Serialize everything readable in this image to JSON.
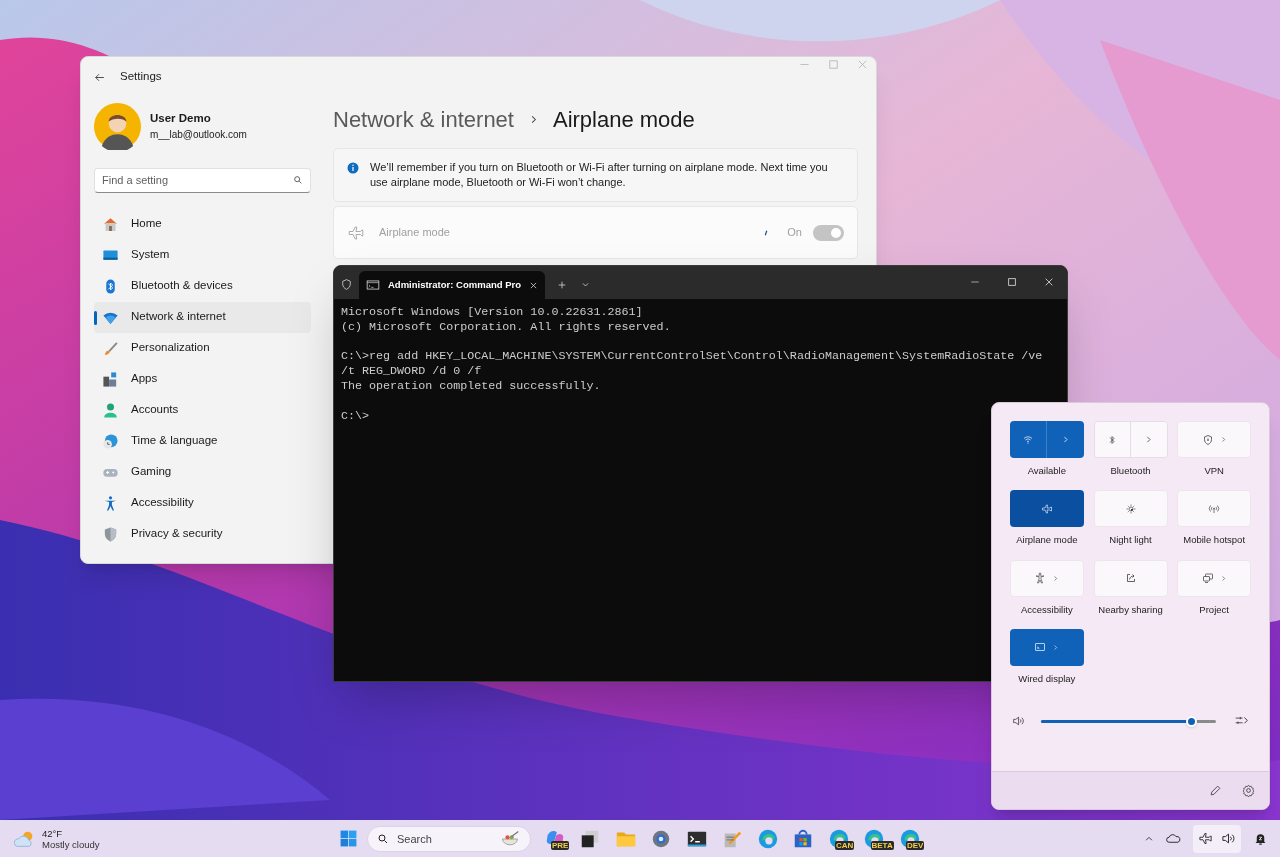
{
  "settings": {
    "title": "Settings",
    "user": {
      "name": "User Demo",
      "email": "m__lab@outlook.com"
    },
    "search": {
      "placeholder": "Find a setting"
    },
    "nav": [
      {
        "label": "Home",
        "selected": false
      },
      {
        "label": "System",
        "selected": false
      },
      {
        "label": "Bluetooth & devices",
        "selected": false
      },
      {
        "label": "Network & internet",
        "selected": true
      },
      {
        "label": "Personalization",
        "selected": false
      },
      {
        "label": "Apps",
        "selected": false
      },
      {
        "label": "Accounts",
        "selected": false
      },
      {
        "label": "Time & language",
        "selected": false
      },
      {
        "label": "Gaming",
        "selected": false
      },
      {
        "label": "Accessibility",
        "selected": false
      },
      {
        "label": "Privacy & security",
        "selected": false
      }
    ],
    "breadcrumb": {
      "parent": "Network & internet",
      "current": "Airplane mode"
    },
    "info": "We’ll remember if you turn on Bluetooth or Wi-Fi after turning on airplane mode. Next time you use airplane mode, Bluetooth or Wi-Fi won’t change.",
    "airplane": {
      "label": "Airplane mode",
      "state": "On",
      "on": true,
      "disabled": true
    }
  },
  "terminal": {
    "tab_title": "Administrator: Command Pro",
    "blocks": [
      [
        "Microsoft Windows [Version 10.0.22631.2861]",
        "(c) Microsoft Corporation. All rights reserved."
      ],
      [
        "C:\\>reg add HKEY_LOCAL_MACHINE\\SYSTEM\\CurrentControlSet\\Control\\RadioManagement\\SystemRadioState /ve",
        "/t REG_DWORD /d 0 /f",
        "The operation completed successfully."
      ],
      [
        "C:\\>"
      ]
    ]
  },
  "quick_settings": {
    "tiles": [
      {
        "label": "Available",
        "kind": "split",
        "on": true
      },
      {
        "label": "Bluetooth",
        "kind": "split",
        "on": false
      },
      {
        "label": "VPN",
        "kind": "arrow",
        "on": false
      },
      {
        "label": "Airplane mode",
        "kind": "plain",
        "on": true
      },
      {
        "label": "Night light",
        "kind": "plain",
        "on": false
      },
      {
        "label": "Mobile hotspot",
        "kind": "plain",
        "on": false
      },
      {
        "label": "Accessibility",
        "kind": "arrow",
        "on": false
      },
      {
        "label": "Nearby sharing",
        "kind": "plain",
        "on": false
      },
      {
        "label": "Project",
        "kind": "arrow",
        "on": false
      },
      {
        "label": "Wired display",
        "kind": "arrow",
        "on": true
      }
    ],
    "volume": {
      "level": 0.855
    }
  },
  "taskbar": {
    "weather": {
      "temp": "42°F",
      "desc": "Mostly cloudy"
    },
    "search": {
      "placeholder": "Search"
    },
    "badges": [
      "PRE",
      "CAN",
      "BETA",
      "DEV"
    ]
  }
}
